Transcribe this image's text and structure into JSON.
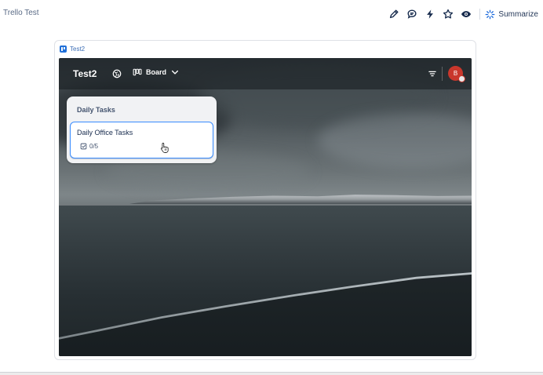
{
  "page": {
    "title": "Trello Test"
  },
  "toolbar": {
    "icons": [
      "pencil-icon",
      "comment-icon",
      "lightning-icon",
      "star-icon",
      "eye-icon"
    ],
    "summarize_label": "Summarize",
    "accent": "#1868db"
  },
  "embed": {
    "source_label": "Test2",
    "board": {
      "title": "Test2",
      "view_label": "Board",
      "avatar_initial": "B",
      "avatar_color": "#c9372c",
      "lists": [
        {
          "title": "Daily Tasks",
          "cards": [
            {
              "title": "Daily Office Tasks",
              "checklist": "0/5"
            }
          ]
        }
      ]
    }
  }
}
